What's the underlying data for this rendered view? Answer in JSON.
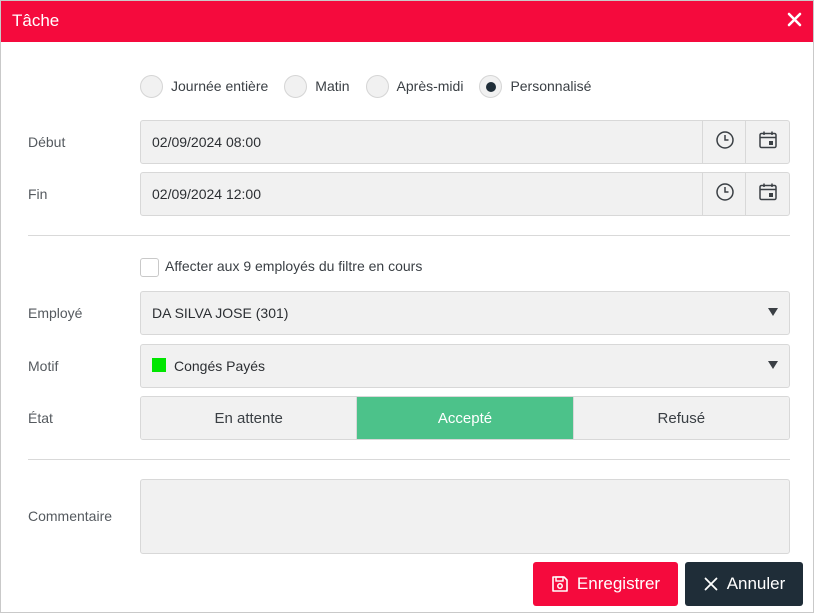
{
  "dialog": {
    "title": "Tâche",
    "colors": {
      "brand": "#f50a3d",
      "dark": "#1f2d38",
      "accepted": "#4cc28a",
      "motif_swatch": "#00e600"
    }
  },
  "period": {
    "options": [
      {
        "label": "Journée entière",
        "checked": false
      },
      {
        "label": "Matin",
        "checked": false
      },
      {
        "label": "Après-midi",
        "checked": false
      },
      {
        "label": "Personnalisé",
        "checked": true
      }
    ]
  },
  "start": {
    "label": "Début",
    "value": "02/09/2024 08:00",
    "clock_icon": "clock-icon",
    "calendar_icon": "calendar-icon"
  },
  "end": {
    "label": "Fin",
    "value": "02/09/2024 12:00",
    "clock_icon": "clock-icon",
    "calendar_icon": "calendar-icon"
  },
  "assign_all": {
    "label": "Affecter aux 9 employés du filtre en cours",
    "checked": false
  },
  "employee": {
    "label": "Employé",
    "value": "DA SILVA JOSE (301)"
  },
  "reason": {
    "label": "Motif",
    "value": "Congés Payés"
  },
  "status": {
    "label": "État",
    "options": [
      {
        "label": "En attente",
        "active": false
      },
      {
        "label": "Accepté",
        "active": true
      },
      {
        "label": "Refusé",
        "active": false
      }
    ]
  },
  "comment": {
    "label": "Commentaire",
    "value": ""
  },
  "actions": {
    "save_label": "Enregistrer",
    "cancel_label": "Annuler"
  }
}
